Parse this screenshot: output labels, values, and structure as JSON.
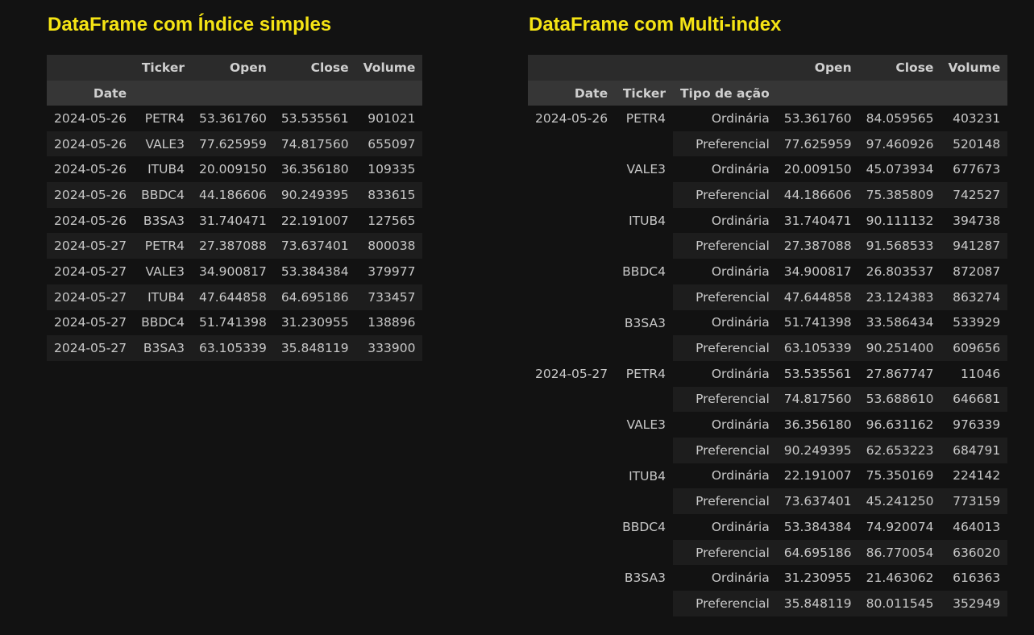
{
  "simple": {
    "title": "DataFrame com Índice simples",
    "columns": [
      "Ticker",
      "Open",
      "Close",
      "Volume"
    ],
    "index_name": "Date",
    "rows": [
      [
        "2024-05-26",
        "PETR4",
        "53.361760",
        "53.535561",
        "901021"
      ],
      [
        "2024-05-26",
        "VALE3",
        "77.625959",
        "74.817560",
        "655097"
      ],
      [
        "2024-05-26",
        "ITUB4",
        "20.009150",
        "36.356180",
        "109335"
      ],
      [
        "2024-05-26",
        "BBDC4",
        "44.186606",
        "90.249395",
        "833615"
      ],
      [
        "2024-05-26",
        "B3SA3",
        "31.740471",
        "22.191007",
        "127565"
      ],
      [
        "2024-05-27",
        "PETR4",
        "27.387088",
        "73.637401",
        "800038"
      ],
      [
        "2024-05-27",
        "VALE3",
        "34.900817",
        "53.384384",
        "379977"
      ],
      [
        "2024-05-27",
        "ITUB4",
        "47.644858",
        "64.695186",
        "733457"
      ],
      [
        "2024-05-27",
        "BBDC4",
        "51.741398",
        "31.230955",
        "138896"
      ],
      [
        "2024-05-27",
        "B3SA3",
        "63.105339",
        "35.848119",
        "333900"
      ]
    ]
  },
  "multi": {
    "title": "DataFrame com Multi-index",
    "columns": [
      "Open",
      "Close",
      "Volume"
    ],
    "index_names": [
      "Date",
      "Ticker",
      "Tipo de ação"
    ],
    "rows": [
      [
        "2024-05-26",
        "PETR4",
        "Ordinária",
        "53.361760",
        "84.059565",
        "403231"
      ],
      [
        "",
        "",
        "Preferencial",
        "77.625959",
        "97.460926",
        "520148"
      ],
      [
        "",
        "VALE3",
        "Ordinária",
        "20.009150",
        "45.073934",
        "677673"
      ],
      [
        "",
        "",
        "Preferencial",
        "44.186606",
        "75.385809",
        "742527"
      ],
      [
        "",
        "ITUB4",
        "Ordinária",
        "31.740471",
        "90.111132",
        "394738"
      ],
      [
        "",
        "",
        "Preferencial",
        "27.387088",
        "91.568533",
        "941287"
      ],
      [
        "",
        "BBDC4",
        "Ordinária",
        "34.900817",
        "26.803537",
        "872087"
      ],
      [
        "",
        "",
        "Preferencial",
        "47.644858",
        "23.124383",
        "863274"
      ],
      [
        "",
        "B3SA3",
        "Ordinária",
        "51.741398",
        "33.586434",
        "533929"
      ],
      [
        "",
        "",
        "Preferencial",
        "63.105339",
        "90.251400",
        "609656"
      ],
      [
        "2024-05-27",
        "PETR4",
        "Ordinária",
        "53.535561",
        "27.867747",
        "11046"
      ],
      [
        "",
        "",
        "Preferencial",
        "74.817560",
        "53.688610",
        "646681"
      ],
      [
        "",
        "VALE3",
        "Ordinária",
        "36.356180",
        "96.631162",
        "976339"
      ],
      [
        "",
        "",
        "Preferencial",
        "90.249395",
        "62.653223",
        "684791"
      ],
      [
        "",
        "ITUB4",
        "Ordinária",
        "22.191007",
        "75.350169",
        "224142"
      ],
      [
        "",
        "",
        "Preferencial",
        "73.637401",
        "45.241250",
        "773159"
      ],
      [
        "",
        "BBDC4",
        "Ordinária",
        "53.384384",
        "74.920074",
        "464013"
      ],
      [
        "",
        "",
        "Preferencial",
        "64.695186",
        "86.770054",
        "636020"
      ],
      [
        "",
        "B3SA3",
        "Ordinária",
        "31.230955",
        "21.463062",
        "616363"
      ],
      [
        "",
        "",
        "Preferencial",
        "35.848119",
        "80.011545",
        "352949"
      ]
    ]
  }
}
